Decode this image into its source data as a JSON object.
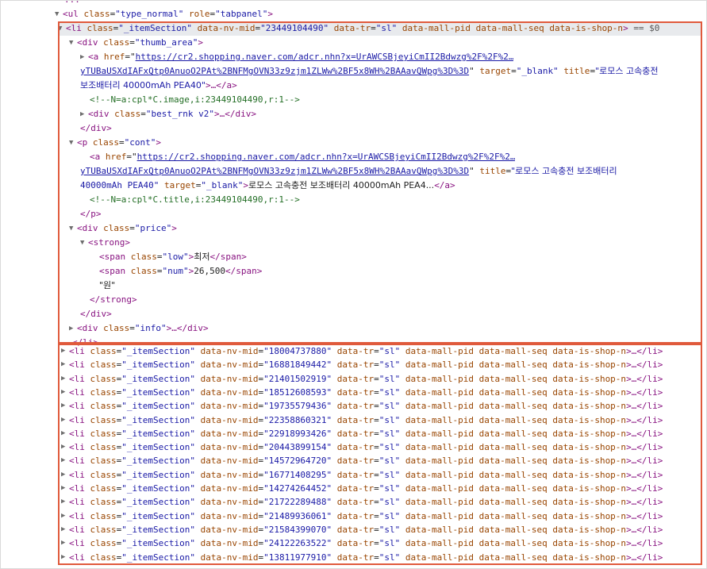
{
  "ul_line": {
    "open": "<ul",
    "attr1_name": "class",
    "attr1_val": "\"type_normal\"",
    "attr2_name": "role",
    "attr2_val": "\"tabpanel\"",
    "close": ">"
  },
  "selected_li": {
    "open": "<li",
    "attr_class_name": "class",
    "attr_class_val": "\"_itemSection\"",
    "attr_mid_name": "data-nv-mid",
    "attr_mid_val": "\"23449104490\"",
    "attr_tr_name": "data-tr",
    "attr_tr_val": "\"sl\"",
    "attr_rest": "data-mall-pid data-mall-seq data-is-shop-n",
    "close": ">",
    "marker": "== $0"
  },
  "thumb_div": {
    "open": "<div",
    "name": "class",
    "val": "\"thumb_area\"",
    "close": ">"
  },
  "thumb_a": {
    "open": "<a",
    "href_name": "href",
    "href_line1": "https://cr2.shopping.naver.com/adcr.nhn?x=UrAWCSBjeyiCmII2Bdwzg%2F%2F%2…",
    "href_line2": "yTUBaUSXdIAFxQtp0AnuoO2PAt%2BNFMgOVN33z9zjm1ZLWw%2BF5x8WH%2BAAavQWpg%3D%3D",
    "target_name": "target",
    "target_val": "\"_blank\"",
    "title_name": "title",
    "title_val_1": "\"로모스 고속충전",
    "title_val_2": "보조배터리 40000mAh PEA40\"",
    "tail": ">…</a>"
  },
  "comment_image": "<!--N=a:cpl*C.image,i:23449104490,r:1-->",
  "best_rnk": {
    "open": "<div",
    "name": "class",
    "val": "\"best_rnk v2\"",
    "tail": ">…</div>"
  },
  "close_div": "</div>",
  "cont_p": {
    "open": "<p",
    "name": "class",
    "val": "\"cont\"",
    "close": ">"
  },
  "cont_a": {
    "open": "<a",
    "href_name": "href",
    "href_line1": "https://cr2.shopping.naver.com/adcr.nhn?x=UrAWCSBjeyiCmII2Bdwzg%2F%2F%2…",
    "href_line2": "yTUBaUSXdIAFxQtp0AnuoO2PAt%2BNFMgOVN33z9zjm1ZLWw%2BF5x8WH%2BAAavQWpg%3D%3D",
    "title_name": "title",
    "title_val_1": "\"로모스 고속충전 보조배터리",
    "title_val_2": "40000mAh PEA40\"",
    "target_name": "target",
    "target_val": "\"_blank\"",
    "text": "로모스 고속충전 보조배터리 40000mAh PEA4...",
    "close": "</a>"
  },
  "comment_title": "<!--N=a:cpl*C.title,i:23449104490,r:1-->",
  "close_p": "</p>",
  "price_div": {
    "open": "<div",
    "name": "class",
    "val": "\"price\"",
    "close": ">"
  },
  "strong_open": "<strong>",
  "span_low": {
    "open": "<span",
    "name": "class",
    "val": "\"low\"",
    "text": "최저",
    "close": "</span>"
  },
  "span_num": {
    "open": "<span",
    "name": "class",
    "val": "\"num\"",
    "text": "26,500",
    "close": "</span>"
  },
  "won_text": "\"원\"",
  "strong_close": "</strong>",
  "info_div": {
    "open": "<div",
    "name": "class",
    "val": "\"info\"",
    "tail": ">…</div>"
  },
  "close_li": "</li>",
  "collapsed_items": {
    "open": "<li",
    "class_name": "class",
    "class_val": "\"_itemSection\"",
    "mid_name": "data-nv-mid",
    "tr_name": "data-tr",
    "tr_val": "\"sl\"",
    "rest": "data-mall-pid data-mall-seq data-is-shop-n",
    "tail": ">…</li>",
    "mids": [
      "\"18004737880\"",
      "\"16881849442\"",
      "\"21401502919\"",
      "\"18512608593\"",
      "\"19735579436\"",
      "\"22358860321\"",
      "\"22918993426\"",
      "\"20443899154\"",
      "\"14572964720\"",
      "\"16771408295\"",
      "\"14274264452\"",
      "\"21722289488\"",
      "\"21489936061\"",
      "\"21584399070\"",
      "\"24122263522\"",
      "\"13811977910\""
    ]
  },
  "colors": {
    "tag": "#881280",
    "attr_name": "#994500",
    "attr_value": "#1a1aa6",
    "comment": "#236e25",
    "highlight_outline": "#e05a3c",
    "selected_row_bg": "#e8eaed"
  }
}
